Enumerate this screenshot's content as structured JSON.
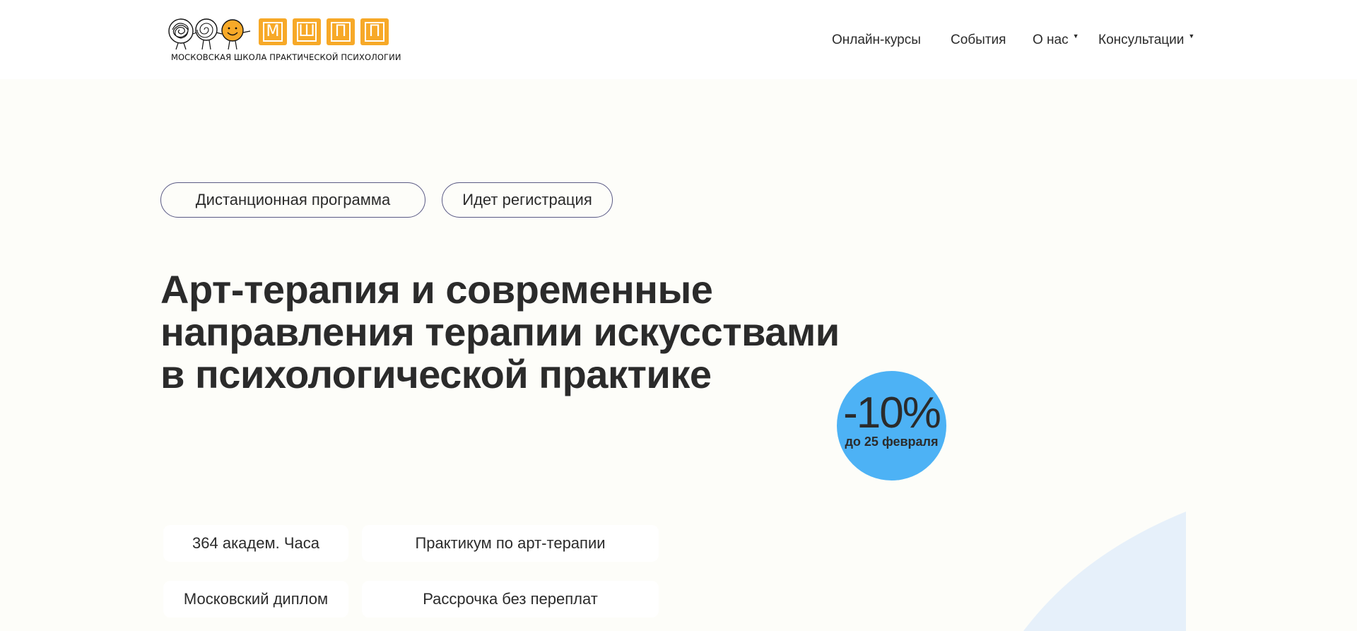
{
  "header": {
    "logo": {
      "letters": [
        "М",
        "Ш",
        "П",
        "П"
      ],
      "tagline": "МОСКОВСКАЯ ШКОЛА ПРАКТИЧЕСКОЙ ПСИХОЛОГИИ",
      "accent_color": "#f7a928"
    },
    "nav": [
      {
        "label": "Онлайн-курсы",
        "has_dropdown": false
      },
      {
        "label": "События",
        "has_dropdown": false
      },
      {
        "label": "О нас",
        "has_dropdown": true
      },
      {
        "label": "Консультации",
        "has_dropdown": true
      }
    ]
  },
  "hero": {
    "tags": [
      "Дистанционная программа",
      "Идет регистрация"
    ],
    "title": "Арт-терапия и современные направления терапии искусствами в психологической практике",
    "discount": {
      "value": "-10%",
      "until": "до 25 февраля",
      "color": "#4db2f5"
    },
    "features": [
      "364 академ. Часа",
      "Практикум по арт-терапии",
      "Московский диплом",
      "Рассрочка без переплат"
    ]
  },
  "icons": {
    "logo_figures": "hand-drawn-faces-icon",
    "dropdown": "caret-down-icon"
  },
  "colors": {
    "page_background": "#fdfdf9",
    "header_background": "#ffffff",
    "text": "#2b2b2b",
    "decor": "#e6f0fa"
  }
}
